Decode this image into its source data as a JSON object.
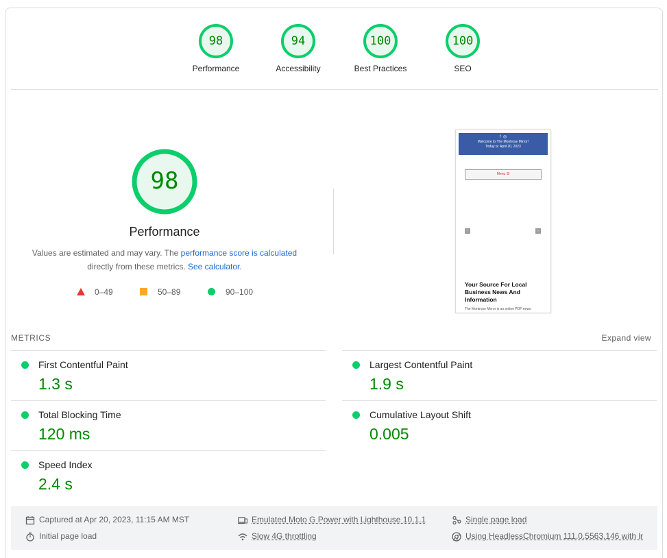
{
  "scores": [
    {
      "value": "98",
      "label": "Performance"
    },
    {
      "value": "94",
      "label": "Accessibility"
    },
    {
      "value": "100",
      "label": "Best Practices"
    },
    {
      "value": "100",
      "label": "SEO"
    }
  ],
  "performance": {
    "score": "98",
    "title": "Performance",
    "desc_before": "Values are estimated and may vary. The ",
    "desc_link": "performance score is calculated",
    "desc_middle": " directly from these metrics. ",
    "desc_link2": "See calculator.",
    "legend": [
      {
        "range": "0–49",
        "shape": "triangle",
        "color": "#e53935"
      },
      {
        "range": "50–89",
        "shape": "square",
        "color": "#ffa726"
      },
      {
        "range": "90–100",
        "shape": "circle",
        "color": "#0cce6b"
      }
    ]
  },
  "screenshot": {
    "welcome": "Welcome to The Montrose Mirror!",
    "date": "Today is: April 20, 2023",
    "menu": "Menu ☰",
    "headline": "Your Source For Local Business News And Information",
    "teaser": "The Montrose Mirror is an online PDF news"
  },
  "metrics": {
    "label": "METRICS",
    "expand": "Expand view",
    "items": [
      {
        "name": "First Contentful Paint",
        "value": "1.3 s"
      },
      {
        "name": "Largest Contentful Paint",
        "value": "1.9 s"
      },
      {
        "name": "Total Blocking Time",
        "value": "120 ms"
      },
      {
        "name": "Cumulative Layout Shift",
        "value": "0.005"
      },
      {
        "name": "Speed Index",
        "value": "2.4 s"
      }
    ]
  },
  "footer": {
    "captured": "Captured at Apr 20, 2023, 11:15 AM MST",
    "initial": "Initial page load",
    "device": "Emulated Moto G Power with Lighthouse 10.1.1",
    "throttling": "Slow 4G throttling",
    "session": "Single page load",
    "browser": "Using HeadlessChromium 111.0.5563.146 with lr"
  },
  "colors": {
    "pass": "#0cce6b",
    "pass_text": "#008800",
    "link": "#1967d2"
  }
}
